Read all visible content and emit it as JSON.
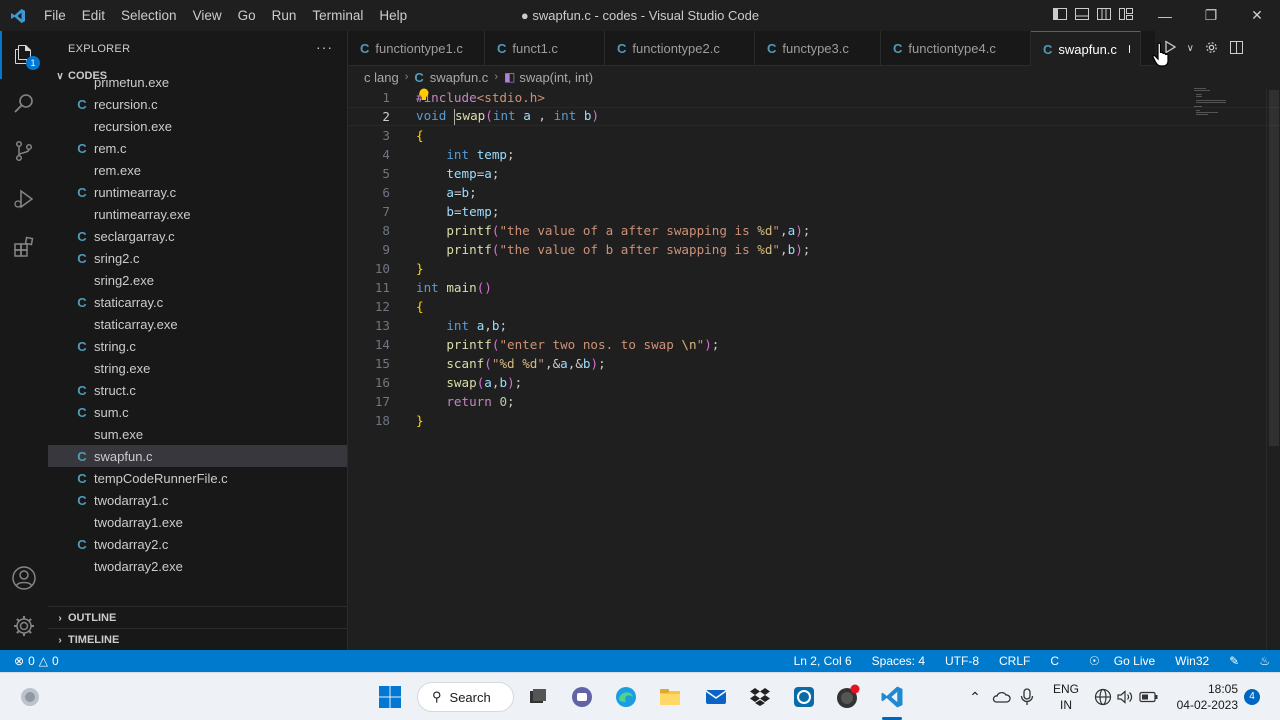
{
  "titlebar": {
    "menu": [
      "File",
      "Edit",
      "Selection",
      "View",
      "Go",
      "Run",
      "Terminal",
      "Help"
    ],
    "window_title": "● swapfun.c - codes - Visual Studio Code"
  },
  "activity": {
    "explorer_badge": "1"
  },
  "sidebar": {
    "header": "EXPLORER",
    "more": "···",
    "folder": "CODES",
    "files": [
      {
        "name": "primefun.exe",
        "icon": "exe"
      },
      {
        "name": "recursion.c",
        "icon": "c"
      },
      {
        "name": "recursion.exe",
        "icon": "exe"
      },
      {
        "name": "rem.c",
        "icon": "c"
      },
      {
        "name": "rem.exe",
        "icon": "exe"
      },
      {
        "name": "runtimearray.c",
        "icon": "c"
      },
      {
        "name": "runtimearray.exe",
        "icon": "exe"
      },
      {
        "name": "seclargarray.c",
        "icon": "c"
      },
      {
        "name": "sring2.c",
        "icon": "c"
      },
      {
        "name": "sring2.exe",
        "icon": "exe"
      },
      {
        "name": "staticarray.c",
        "icon": "c"
      },
      {
        "name": "staticarray.exe",
        "icon": "exe"
      },
      {
        "name": "string.c",
        "icon": "c"
      },
      {
        "name": "string.exe",
        "icon": "exe"
      },
      {
        "name": "struct.c",
        "icon": "c"
      },
      {
        "name": "sum.c",
        "icon": "c"
      },
      {
        "name": "sum.exe",
        "icon": "exe"
      },
      {
        "name": "swapfun.c",
        "icon": "c",
        "selected": true
      },
      {
        "name": "tempCodeRunnerFile.c",
        "icon": "c"
      },
      {
        "name": "twodarray1.c",
        "icon": "c"
      },
      {
        "name": "twodarray1.exe",
        "icon": "exe"
      },
      {
        "name": "twodarray2.c",
        "icon": "c"
      },
      {
        "name": "twodarray2.exe",
        "icon": "exe"
      }
    ],
    "outline": "OUTLINE",
    "timeline": "TIMELINE"
  },
  "tabs": [
    {
      "label": "functiontype1.c",
      "active": false
    },
    {
      "label": "funct1.c",
      "active": false
    },
    {
      "label": "functiontype2.c",
      "active": false
    },
    {
      "label": "functype3.c",
      "active": false
    },
    {
      "label": "functiontype4.c",
      "active": false
    },
    {
      "label": "swapfun.c",
      "active": true,
      "dirty": true
    }
  ],
  "breadcrumb": {
    "folder": "c lang",
    "file": "swapfun.c",
    "symbol": "swap(int, int)"
  },
  "editor": {
    "current_line": 2,
    "lines": [
      "#include<stdio.h>",
      "void swap(int a , int b)",
      "{",
      "    int temp;",
      "    temp=a;",
      "    a=b;",
      "    b=temp;",
      "    printf(\"the value of a after swapping is %d\",a);",
      "    printf(\"the value of b after swapping is %d\",b);",
      "}",
      "int main()",
      "{",
      "    int a,b;",
      "    printf(\"enter two nos. to swap \\n\");",
      "    scanf(\"%d %d\",&a,&b);",
      "    swap(a,b);",
      "    return 0;",
      "}"
    ]
  },
  "statusbar": {
    "errors": "0",
    "warnings": "0",
    "position": "Ln 2, Col 6",
    "spaces": "Spaces: 4",
    "encoding": "UTF-8",
    "eol": "CRLF",
    "language": "C",
    "golive": "Go Live",
    "platform": "Win32"
  },
  "taskbar": {
    "search_label": "Search",
    "lang_line1": "ENG",
    "lang_line2": "IN",
    "time": "18:05",
    "date": "04-02-2023",
    "notification_count": "4"
  },
  "colors": {
    "accent": "#007acc",
    "c_icon": "#519aba"
  }
}
